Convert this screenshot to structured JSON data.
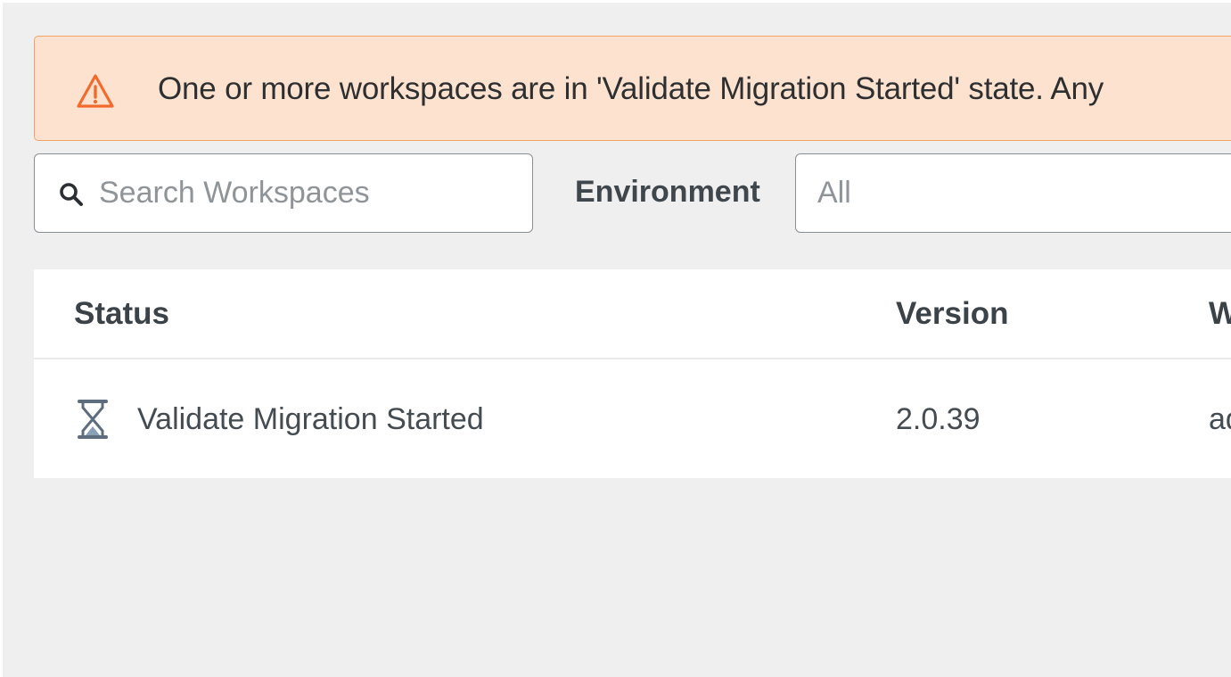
{
  "banner": {
    "message": "One or more workspaces are in 'Validate Migration Started' state. Any",
    "icon": "warning-triangle-icon",
    "accent_color": "#f26b2c",
    "background_color": "#fde3cf"
  },
  "filters": {
    "search_placeholder": "Search Workspaces",
    "search_value": "",
    "search_icon": "search-icon",
    "environment_label": "Environment",
    "environment_value": "All"
  },
  "table": {
    "columns": [
      "Status",
      "Version",
      "W"
    ],
    "rows": [
      {
        "status_icon": "hourglass-icon",
        "status": "Validate Migration Started",
        "version": "2.0.39",
        "workspace": "ad"
      }
    ]
  }
}
